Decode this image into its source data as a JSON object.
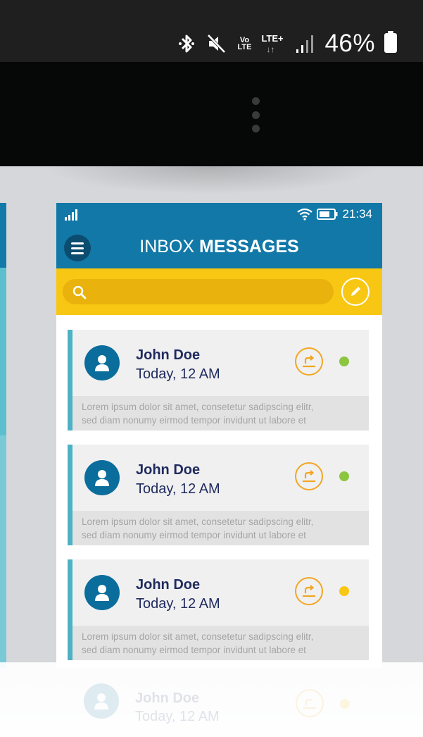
{
  "status_bar": {
    "battery_percent": "46%",
    "volte_top": "Vo",
    "volte_bottom": "LTE",
    "lte": "LTE+",
    "lte_arrows": "↓↑",
    "icons": [
      "bluetooth-icon",
      "mute-icon",
      "volte-icon",
      "lte-icon",
      "signal-icon",
      "battery-icon"
    ]
  },
  "toolbar": {
    "menu_icon": "more-vert-icon"
  },
  "mockup": {
    "status": {
      "time": "21:34"
    },
    "title_light": "INBOX ",
    "title_bold": "MESSAGES",
    "search": {
      "placeholder": ""
    },
    "colors": {
      "header": "#1178a7",
      "search_bar": "#f8c713",
      "accent": "#4cb2c5",
      "reply": "#f2a623"
    },
    "messages": [
      {
        "name": "John Doe",
        "time": "Today, 12 AM",
        "preview_line1": "Lorem ipsum dolor sit amet, consetetur sadipscing elitr,",
        "preview_line2": "sed diam nonumy eirmod tempor invidunt ut labore et",
        "status_color": "#8cc540"
      },
      {
        "name": "John Doe",
        "time": "Today, 12 AM",
        "preview_line1": "Lorem ipsum dolor sit amet, consetetur sadipscing elitr,",
        "preview_line2": "sed diam nonumy eirmod tempor invidunt ut labore et",
        "status_color": "#8cc540"
      },
      {
        "name": "John Doe",
        "time": "Today, 12 AM",
        "preview_line1": "Lorem ipsum dolor sit amet, consetetur sadipscing elitr,",
        "preview_line2": "sed diam nonumy eirmod tempor invidunt ut labore et",
        "status_color": "#f8c713"
      }
    ],
    "reflection": {
      "name": "John Doe",
      "time": "Today, 12 AM"
    }
  }
}
